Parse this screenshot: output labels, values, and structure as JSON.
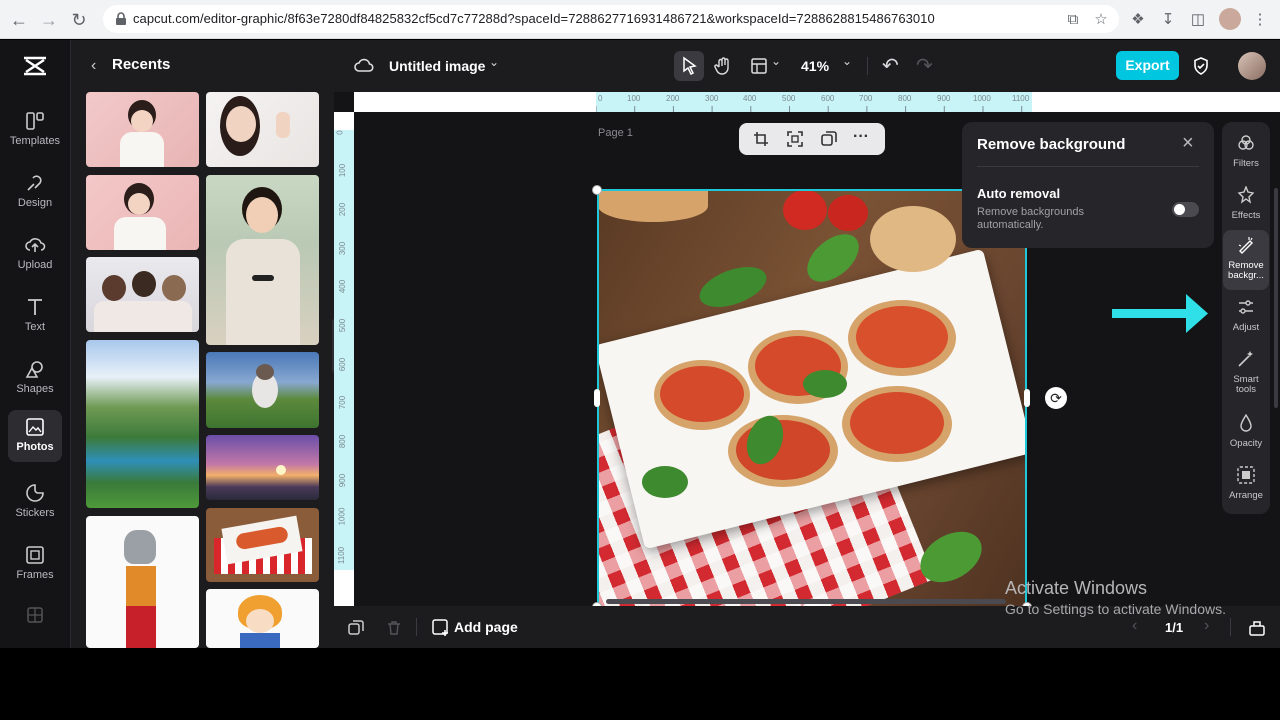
{
  "browser": {
    "url": "capcut.com/editor-graphic/8f63e7280df84825832cf5cd7c77288d?spaceId=7288627716931486721&workspaceId=7288628815486763010"
  },
  "nav": {
    "items": [
      {
        "label": "Templates",
        "icon": "templates-icon"
      },
      {
        "label": "Design",
        "icon": "design-icon"
      },
      {
        "label": "Upload",
        "icon": "upload-icon"
      },
      {
        "label": "Text",
        "icon": "text-icon"
      },
      {
        "label": "Shapes",
        "icon": "shapes-icon"
      },
      {
        "label": "Photos",
        "icon": "photos-icon",
        "active": true
      },
      {
        "label": "Stickers",
        "icon": "stickers-icon"
      },
      {
        "label": "Frames",
        "icon": "frames-icon"
      }
    ]
  },
  "panel": {
    "title": "Recents"
  },
  "topbar": {
    "doc_title": "Untitled image",
    "zoom": "41%",
    "export_label": "Export"
  },
  "canvas": {
    "page_label": "Page 1",
    "ruler_top_ticks": [
      "0",
      "100",
      "200",
      "300",
      "400",
      "500",
      "600",
      "700",
      "800",
      "900",
      "1000",
      "1100"
    ],
    "ruler_left_ticks": [
      "0",
      "100",
      "200",
      "300",
      "400",
      "500",
      "600",
      "700",
      "800",
      "900",
      "1000",
      "1100"
    ]
  },
  "remove_bg": {
    "title": "Remove background",
    "option_title": "Auto removal",
    "option_desc": "Remove backgrounds automatically.",
    "toggle_on": false
  },
  "rail": {
    "items": [
      {
        "label": "Filters",
        "icon": "filters-icon"
      },
      {
        "label": "Effects",
        "icon": "effects-icon"
      },
      {
        "label": "Remove backgr...",
        "icon": "remove-background-icon",
        "active": true
      },
      {
        "label": "Adjust",
        "icon": "adjust-icon"
      },
      {
        "label": "Smart tools",
        "icon": "smart-tools-icon"
      },
      {
        "label": "Opacity",
        "icon": "opacity-icon"
      },
      {
        "label": "Arrange",
        "icon": "arrange-icon"
      }
    ]
  },
  "bottombar": {
    "add_page_label": "Add page",
    "page_counter": "1/1"
  },
  "watermark": {
    "line1": "Activate Windows",
    "line2": "Go to Settings to activate Windows."
  },
  "colors": {
    "accent": "#00c6e0",
    "arrow": "#2fe0e8"
  }
}
